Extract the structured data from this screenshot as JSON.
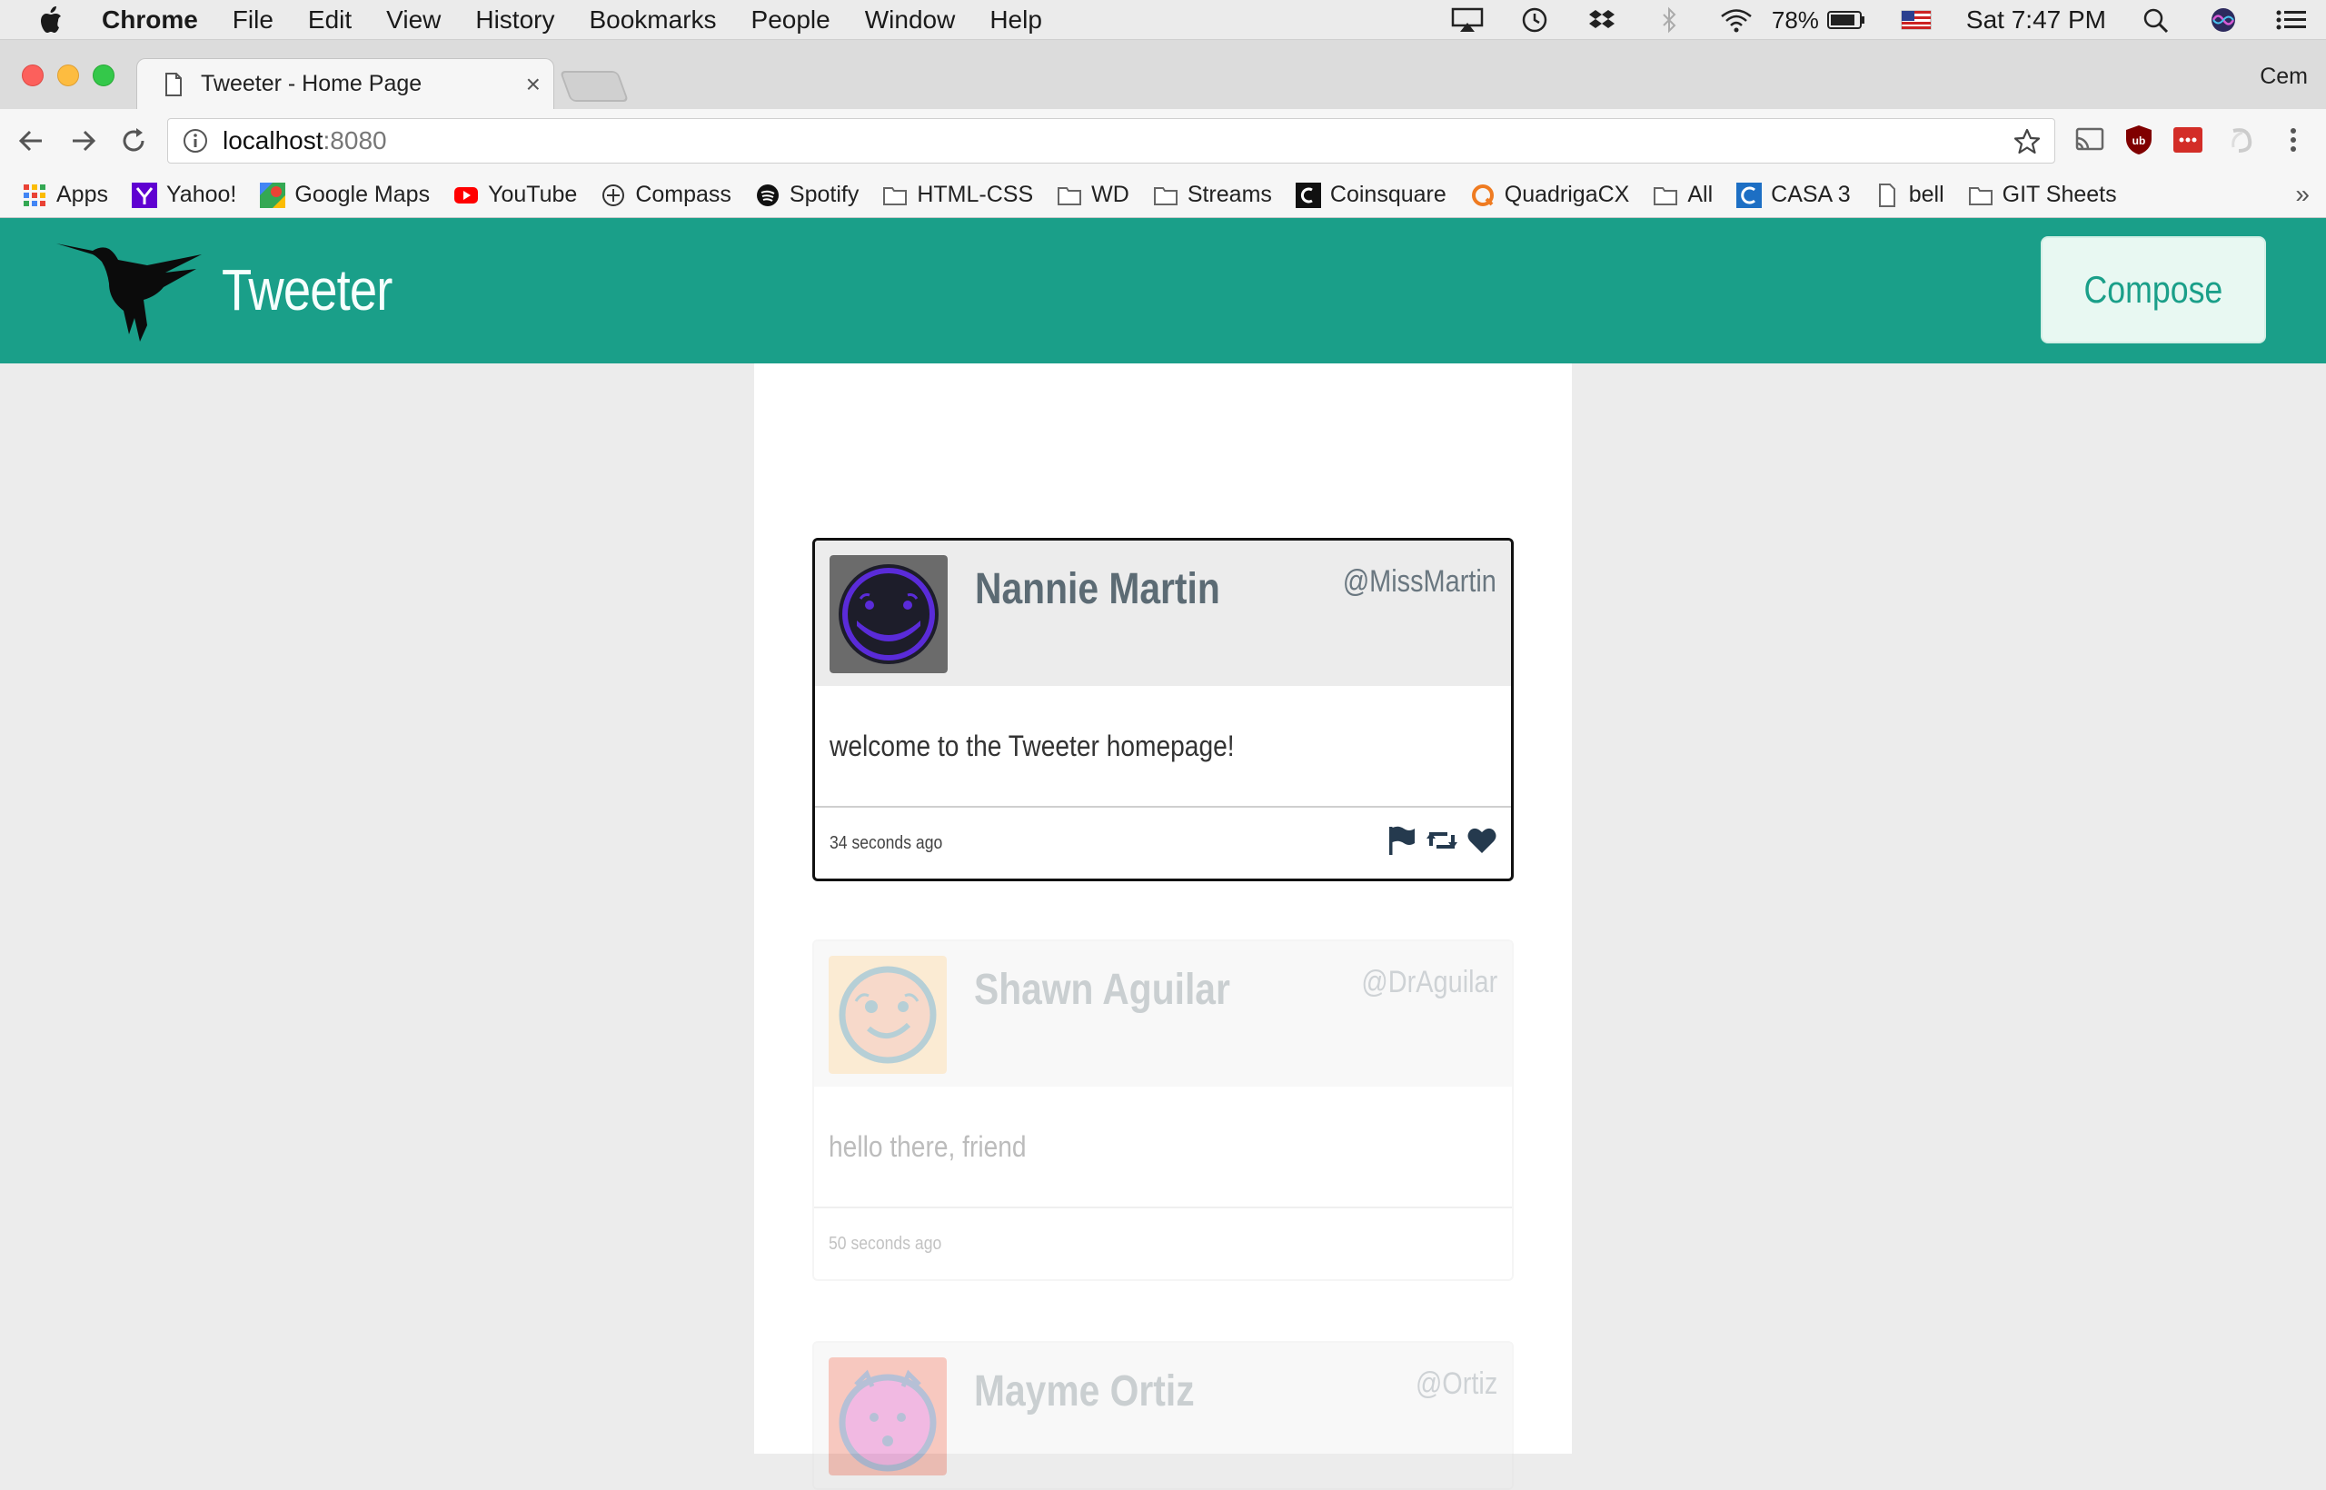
{
  "menubar": {
    "app": "Chrome",
    "items": [
      "File",
      "Edit",
      "View",
      "History",
      "Bookmarks",
      "People",
      "Window",
      "Help"
    ],
    "battery": "78%",
    "clock": "Sat 7:47 PM"
  },
  "browser": {
    "tab_title": "Tweeter - Home Page",
    "tab_close": "×",
    "profile": "Cem",
    "url_host": "localhost",
    "url_port": ":8080"
  },
  "bookmarks": [
    {
      "label": "Apps",
      "icon": "apps-grid-icon"
    },
    {
      "label": "Yahoo!",
      "icon": "yahoo-icon"
    },
    {
      "label": "Google Maps",
      "icon": "google-maps-icon"
    },
    {
      "label": "YouTube",
      "icon": "youtube-icon"
    },
    {
      "label": "Compass",
      "icon": "compass-icon"
    },
    {
      "label": "Spotify",
      "icon": "spotify-icon"
    },
    {
      "label": "HTML-CSS",
      "icon": "folder-icon"
    },
    {
      "label": "WD",
      "icon": "folder-icon"
    },
    {
      "label": "Streams",
      "icon": "folder-icon"
    },
    {
      "label": "Coinsquare",
      "icon": "coinsquare-icon"
    },
    {
      "label": "QuadrigaCX",
      "icon": "quadrigacx-icon"
    },
    {
      "label": "All",
      "icon": "folder-icon"
    },
    {
      "label": "CASA 3",
      "icon": "casa-icon"
    },
    {
      "label": "bell",
      "icon": "document-icon"
    },
    {
      "label": "GIT Sheets",
      "icon": "folder-icon"
    }
  ],
  "bookmarks_more": "»",
  "app": {
    "title": "Tweeter",
    "compose_label": "Compose",
    "brand_color": "#1a9f89"
  },
  "tweets": [
    {
      "name": "Nannie Martin",
      "handle": "@MissMartin",
      "text": "welcome to the Tweeter homepage!",
      "time": "34 seconds ago",
      "avatar_bg": "#6b6b6b",
      "avatar_fg": "#5a2bd9"
    },
    {
      "name": "Shawn Aguilar",
      "handle": "@DrAguilar",
      "text": "hello there, friend",
      "time": "50 seconds ago",
      "avatar_bg": "#f5c27a",
      "avatar_fg": "#1f6d82"
    },
    {
      "name": "Mayme Ortiz",
      "handle": "@Ortiz",
      "text": "",
      "time": "",
      "avatar_bg": "#e8563a",
      "avatar_fg": "#d52aa8"
    }
  ]
}
